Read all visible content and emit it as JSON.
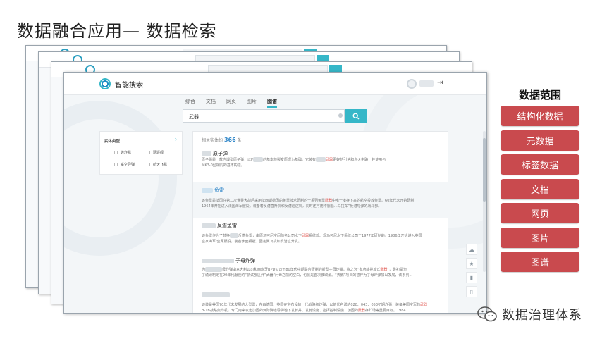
{
  "slide": {
    "title": "数据融合应用— 数据检索"
  },
  "app": {
    "name": "智能搜索",
    "tabs": [
      "综合",
      "文档",
      "网页",
      "图片",
      "图谱"
    ],
    "active_tab": "图谱",
    "search": {
      "value": "武器"
    },
    "logout_icon": "logout-icon"
  },
  "filter": {
    "title": "实体类型",
    "options": [
      "轰炸机",
      "驱逐舰",
      "垂空导弹",
      "航天飞机"
    ]
  },
  "results_header": {
    "prefix": "相关实体约",
    "count": "366",
    "suffix": "条"
  },
  "results": [
    {
      "title": "原子弹",
      "text_a": "原子弹是一款内爆型原子弹，以P",
      "text_b": "的基本核裂变原理为基础。它装有",
      "kw": "武器",
      "text_c": "更好的引信和点火电路，并使用与",
      "text_d": "MK3-0型相同的基本构造。"
    },
    {
      "title": "鱼雷",
      "text_a": "该鱼雷是法国在第二次世界大战后采用法西斯德国的鱼雷技术研制的一系列鱼雷",
      "kw": "武器",
      "text_c": "中唯一凑存下来的航空投放鱼雷。60年代末开始研制，",
      "text_d": "1964年开始进入法国海军服役。装备着反潜直升机和反潜巡逻机，同时还可用作舰船…马拉车”反潜导弹的战斗部。"
    },
    {
      "title": "反潜鱼雷",
      "text_a": "该鱼雷作为了替换",
      "text_b": "反潜鱼雷，由原马可尼空间防务公司水下",
      "kw": "武器",
      "text_c": "系统部、现马可尼水下系统公司于1977年研制的。1986年开始进入英国",
      "text_d": "皇家海军/空军服役，装备水面舰艇、固定翼飞机和反潜直升机。"
    },
    {
      "title": "子母炸弹",
      "text_a": "为",
      "text_b": "母炸弹由意大利公司和西班牙BPD公司于80年代中期联合研制的新型子母炸弹，将之为“多功能投放式",
      "kw": "武器",
      "text_c": "”，最初是为",
      "text_d": "了确研制定在90年代服役的“航试部区外”武器“问世之前的空白，也就是首次被取消。“天鹅”项目的替作为子母炸弹加以发展，该系列…"
    },
    {
      "title": "",
      "text_a": "该装是美国70年代末发展的大型雷，在由德国、英国在空布设的一代战略级炸弹，以前代名试的028、043、053初期炸弹，装备美国空军的",
      "kw": "武器",
      "text_c": "",
      "text_d": "B-1B战略轰炸机，专门用来攻击加固的洲际弹道导弹地下发射井、发射设施、指挥控制设施、加固的",
      "text_e": "存贮场等重要目标。1984…"
    }
  ],
  "side_tools": [
    "cloud-icon",
    "star-icon",
    "chart-icon",
    "bookmark-icon"
  ],
  "scope": {
    "title": "数据范围",
    "items": [
      "结构化数据",
      "元数据",
      "标签数据",
      "文档",
      "网页",
      "图片",
      "图谱"
    ],
    "color": "#c94a4e"
  },
  "watermark": {
    "text": "数据治理体系"
  },
  "colors": {
    "accent": "#36b7c8",
    "link": "#2f86c8",
    "keyword": "#e0554e"
  }
}
